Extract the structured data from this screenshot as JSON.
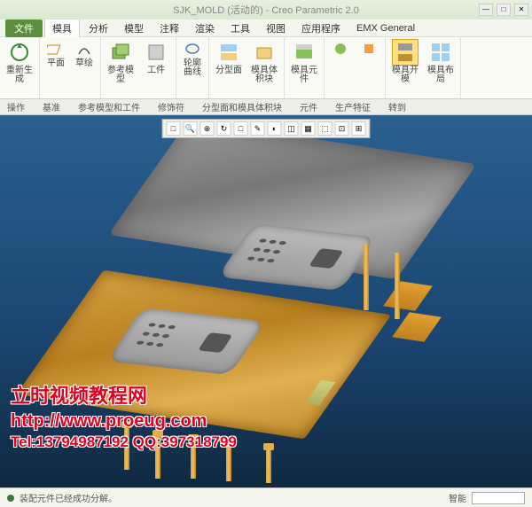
{
  "window": {
    "title": "SJK_MOLD (活动的) - Creo Parametric 2.0"
  },
  "menu": {
    "file": "文件",
    "items": [
      "模具",
      "分析",
      "模型",
      "注释",
      "渲染",
      "工具",
      "视图",
      "应用程序",
      "EMX General"
    ],
    "active_index": 0
  },
  "ribbon": {
    "groups": [
      {
        "label": "操作",
        "items": [
          {
            "icon": "regen",
            "label": "重新生成"
          }
        ]
      },
      {
        "label": "基准",
        "items": [
          {
            "icon": "plane",
            "label": "平面"
          },
          {
            "icon": "sketch",
            "label": "草绘"
          }
        ]
      },
      {
        "label": "参考模型和工件",
        "items": [
          {
            "icon": "refmodel",
            "label": "参考模型"
          },
          {
            "icon": "workpiece",
            "label": "工件"
          }
        ]
      },
      {
        "label": "修饰符",
        "items": [
          {
            "icon": "silhouette",
            "label": "轮廓曲线"
          }
        ]
      },
      {
        "label": "分型面和模具体积块",
        "items": [
          {
            "icon": "parting",
            "label": "分型面"
          },
          {
            "icon": "volume",
            "label": "模具体积块"
          }
        ]
      },
      {
        "label": "元件",
        "items": [
          {
            "icon": "component",
            "label": "模具元件"
          }
        ]
      },
      {
        "label": "生产特征",
        "items": [
          {
            "icon": "prod1",
            "label": ""
          },
          {
            "icon": "prod2",
            "label": ""
          }
        ]
      },
      {
        "label": "转到",
        "items": [
          {
            "icon": "open",
            "label": "模具开模",
            "highlight": true
          },
          {
            "icon": "layout",
            "label": "模具布局"
          }
        ]
      }
    ]
  },
  "viewport_toolbar": {
    "buttons": [
      "□",
      "🔍",
      "⊕",
      "↻",
      "□",
      "✎",
      "◐",
      "◫",
      "▦",
      "⬚",
      "⊡",
      "⊞"
    ]
  },
  "watermark": {
    "line1": "立时视频教程网",
    "line2": "http://www.proeug.com",
    "line3": "Tel:13794987192  QQ:397318799"
  },
  "status": {
    "message": "装配元件已经成功分解。",
    "right_label": "智能"
  }
}
